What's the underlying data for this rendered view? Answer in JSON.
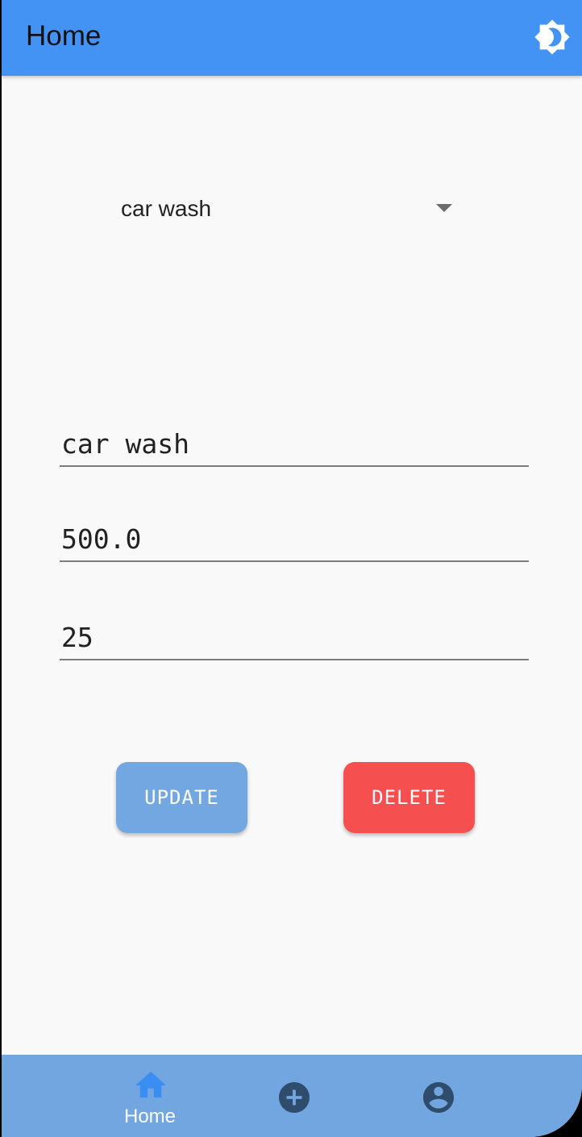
{
  "app_bar": {
    "title": "Home",
    "theme_icon": "brightness-icon"
  },
  "dropdown": {
    "selected": "car wash",
    "icon": "arrow-drop-down-icon"
  },
  "form": {
    "name_value": "car wash",
    "price_value": "500.0",
    "quantity_value": "25"
  },
  "buttons": {
    "update_label": "UPDATE",
    "delete_label": "DELETE"
  },
  "bottom_nav": {
    "home_label": "Home",
    "items": [
      {
        "icon": "home-icon",
        "active": true
      },
      {
        "icon": "add-circle-icon",
        "active": false
      },
      {
        "icon": "account-circle-icon",
        "active": false
      }
    ]
  },
  "colors": {
    "app_bar": "#4293f4",
    "background": "#f9f9f9",
    "update_button": "#72a7e1",
    "delete_button": "#f64f50",
    "bottom_nav": "#72a6e0",
    "nav_active_icon": "#3a8ef2",
    "nav_inactive_icon": "#2f4c6d"
  }
}
